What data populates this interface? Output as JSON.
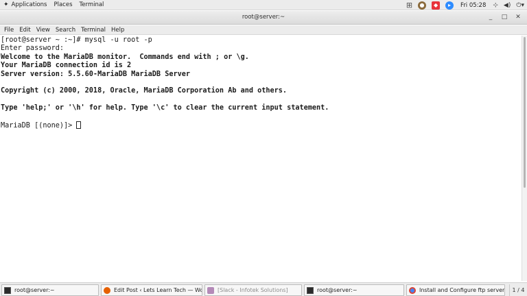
{
  "top_panel": {
    "applications": "Applications",
    "places": "Places",
    "terminal": "Terminal",
    "clock": "Fri 05:28"
  },
  "window": {
    "title": "root@server:~"
  },
  "menubar": {
    "items": [
      "File",
      "Edit",
      "View",
      "Search",
      "Terminal",
      "Help"
    ]
  },
  "terminal": {
    "lines": [
      {
        "text": "[root@server ~ :~]# mysql -u root -p",
        "bold": false
      },
      {
        "text": "Enter password:",
        "bold": false
      },
      {
        "text": "Welcome to the MariaDB monitor.  Commands end with ; or \\g.",
        "bold": true
      },
      {
        "text": "Your MariaDB connection id is 2",
        "bold": true
      },
      {
        "text": "Server version: 5.5.60-MariaDB MariaDB Server",
        "bold": true
      },
      {
        "text": "",
        "bold": false
      },
      {
        "text": "Copyright (c) 2000, 2018, Oracle, MariaDB Corporation Ab and others.",
        "bold": true
      },
      {
        "text": "",
        "bold": false
      },
      {
        "text": "Type 'help;' or '\\h' for help. Type '\\c' to clear the current input statement.",
        "bold": true
      },
      {
        "text": "",
        "bold": false
      }
    ],
    "prompt": "MariaDB [(none)]> "
  },
  "taskbar": {
    "tasks": [
      {
        "label": "root@server:~",
        "icon": "terminal-icon"
      },
      {
        "label": "Edit Post ‹ Lets Learn Tech — Wor...",
        "icon": "firefox-icon"
      },
      {
        "label": "[Slack - Infotek Solutions]",
        "icon": "slack-icon"
      },
      {
        "label": "root@server:~",
        "icon": "terminal-icon"
      },
      {
        "label": "Install and Configure ftp server in c...",
        "icon": "chrome-icon"
      }
    ],
    "pager": "1 / 4"
  }
}
